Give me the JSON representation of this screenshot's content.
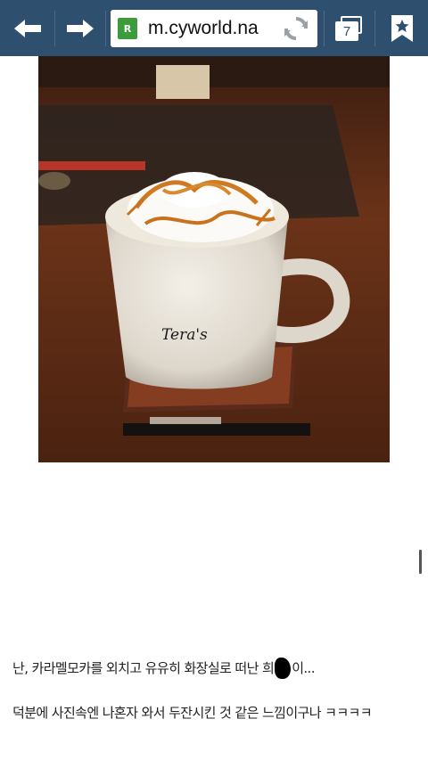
{
  "browser": {
    "url": "m.cyworld.na",
    "tab_count": "7",
    "favicon": "R",
    "toolbar_color": "#2e4f6e"
  },
  "post": {
    "mug_text": "Tera's",
    "line1": "난, 카라멜모카를 외치고 유유히 화장실로 떠난 희",
    "line1_end": "이...",
    "line2": "덕분에 사진속엔 나혼자 와서 두잔시킨 것 같은 느낌이구나 ㅋㅋㅋㅋ"
  }
}
